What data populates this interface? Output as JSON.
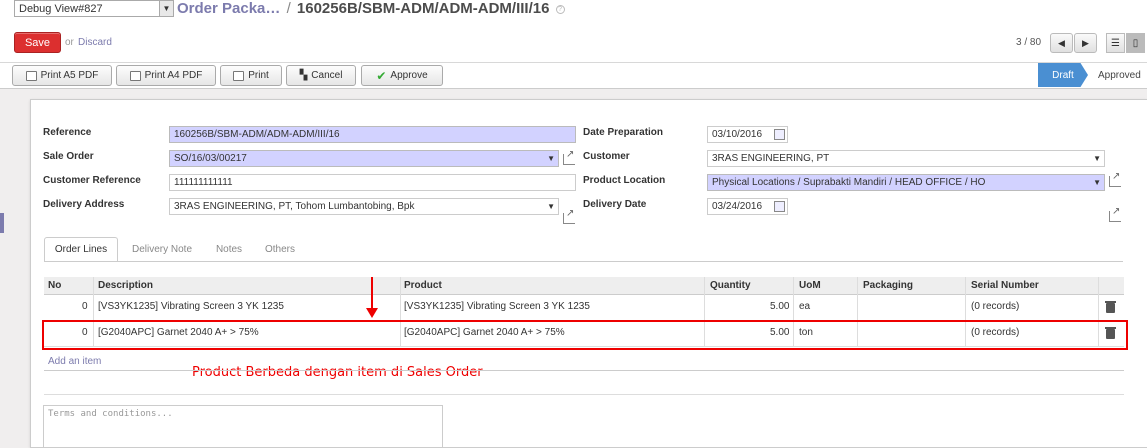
{
  "header": {
    "debug_select": "Debug View#827",
    "breadcrumb_parent": "Order Packa…",
    "breadcrumb_separator": "/",
    "breadcrumb_current": "160256B/SBM-ADM/ADM-ADM/III/16"
  },
  "actions": {
    "save_label": "Save",
    "or_label": "or",
    "discard_label": "Discard",
    "pager": "3 / 80"
  },
  "toolbar": {
    "print_a5": "Print A5 PDF",
    "print_a4": "Print A4 PDF",
    "print": "Print",
    "cancel": "Cancel",
    "approve": "Approve"
  },
  "status": {
    "draft": "Draft",
    "approved": "Approved",
    "active_color": "#4a8fd2"
  },
  "form": {
    "reference_label": "Reference",
    "reference_value": "160256B/SBM-ADM/ADM-ADM/III/16",
    "sale_order_label": "Sale Order",
    "sale_order_value": "SO/16/03/00217",
    "customer_ref_label": "Customer Reference",
    "customer_ref_value": "111111111111",
    "delivery_address_label": "Delivery Address",
    "delivery_address_value": "3RAS ENGINEERING, PT, Tohom Lumbantobing, Bpk",
    "date_prep_label": "Date Preparation",
    "date_prep_value": "03/10/2016",
    "customer_label": "Customer",
    "customer_value": "3RAS ENGINEERING, PT",
    "product_location_label": "Product Location",
    "product_location_value": "Physical Locations / Suprabakti Mandiri / HEAD OFFICE / HO",
    "delivery_date_label": "Delivery Date",
    "delivery_date_value": "03/24/2016"
  },
  "tabs": [
    {
      "label": "Order Lines"
    },
    {
      "label": "Delivery Note"
    },
    {
      "label": "Notes"
    },
    {
      "label": "Others"
    }
  ],
  "table": {
    "headers": [
      "No",
      "Description",
      "Product",
      "Quantity",
      "UoM",
      "Packaging",
      "Serial Number"
    ],
    "rows": [
      {
        "no": "0",
        "description": "[VS3YK1235] Vibrating Screen 3 YK 1235",
        "product": "[VS3YK1235] Vibrating Screen 3 YK 1235",
        "quantity": "5.00",
        "uom": "ea",
        "packaging": "",
        "serial": "(0 records)"
      },
      {
        "no": "0",
        "description": "[G2040APC] Garnet 2040 A+ > 75%",
        "product": "[G2040APC] Garnet 2040 A+ > 75%",
        "quantity": "5.00",
        "uom": "ton",
        "packaging": "",
        "serial": "(0 records)"
      }
    ],
    "add_item": "Add an item"
  },
  "annotation": "Product Berbeda dengan item di Sales Order",
  "terms_placeholder": "Terms and conditions..."
}
